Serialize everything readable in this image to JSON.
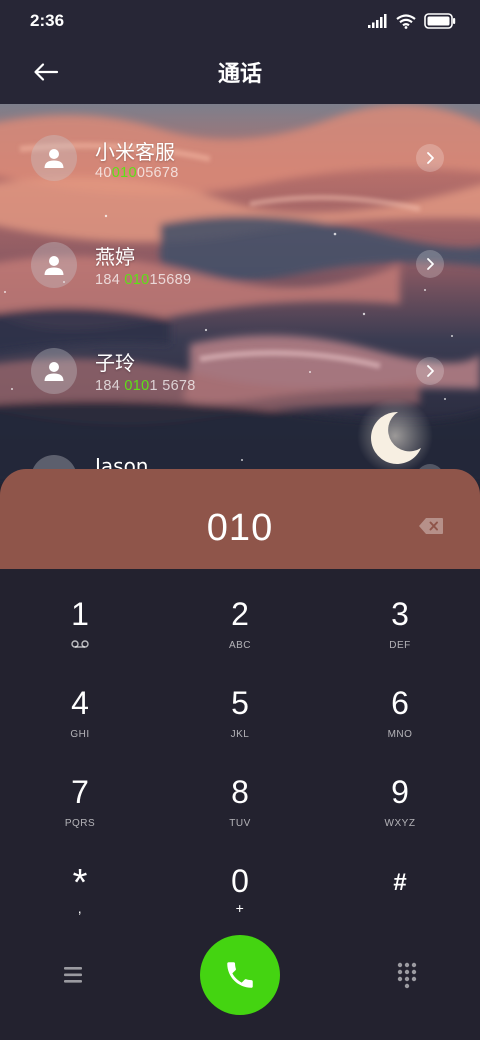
{
  "status_bar": {
    "time": "2:36",
    "icons": [
      "signal-icon",
      "wifi-icon",
      "battery-icon"
    ]
  },
  "header": {
    "title": "通话",
    "back_icon": "back-arrow-icon"
  },
  "contacts": [
    {
      "name": "小米客服",
      "number_pre": "40",
      "number_match": "010",
      "number_post": "05678"
    },
    {
      "name": "燕婷",
      "number_pre": "184 ",
      "number_match": "010",
      "number_post": "15689"
    },
    {
      "name": "子玲",
      "number_pre": "184 ",
      "number_match": "010",
      "number_post": "1 5678"
    },
    {
      "name": "Jason",
      "number_pre": "",
      "number_match": "",
      "number_post": ""
    }
  ],
  "dialer": {
    "number": "010",
    "backspace_icon": "backspace-icon"
  },
  "keypad": [
    {
      "digit": "1",
      "letters": "",
      "icon": "voicemail-icon"
    },
    {
      "digit": "2",
      "letters": "ABC"
    },
    {
      "digit": "3",
      "letters": "DEF"
    },
    {
      "digit": "4",
      "letters": "GHI"
    },
    {
      "digit": "5",
      "letters": "JKL"
    },
    {
      "digit": "6",
      "letters": "MNO"
    },
    {
      "digit": "7",
      "letters": "PQRS"
    },
    {
      "digit": "8",
      "letters": "TUV"
    },
    {
      "digit": "9",
      "letters": "WXYZ"
    },
    {
      "digit": "*",
      "letters": ","
    },
    {
      "digit": "0",
      "letters": "+"
    },
    {
      "digit": "#",
      "letters": ""
    }
  ],
  "bottom_bar": {
    "menu_icon": "menu-icon",
    "call_icon": "phone-icon",
    "keypad_icon": "dialpad-icon"
  },
  "colors": {
    "highlight": "#5ee017",
    "call_button": "#44d411",
    "display_bg": "#8f554a",
    "keypad_bg": "#23222f"
  }
}
